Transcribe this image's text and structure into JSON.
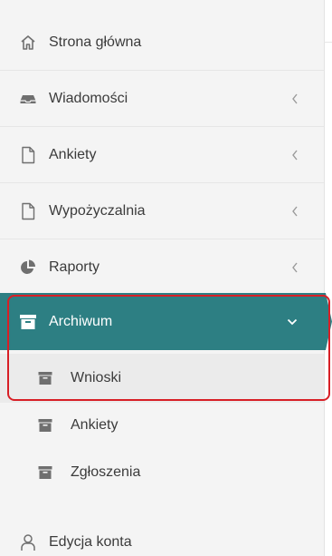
{
  "menu": {
    "items": [
      {
        "label": "Strona główna",
        "icon": "home-icon"
      },
      {
        "label": "Wiadomości",
        "icon": "inbox-icon"
      },
      {
        "label": "Ankiety",
        "icon": "file-icon"
      },
      {
        "label": "Wypożyczalnia",
        "icon": "file-icon"
      },
      {
        "label": "Raporty",
        "icon": "pie-chart-icon"
      }
    ],
    "active": {
      "label": "Archiwum",
      "icon": "archive-icon"
    },
    "subitems": [
      {
        "label": "Wnioski",
        "icon": "archive-icon",
        "selected": true
      },
      {
        "label": "Ankiety",
        "icon": "archive-icon",
        "selected": false
      },
      {
        "label": "Zgłoszenia",
        "icon": "archive-icon",
        "selected": false
      }
    ],
    "account": {
      "label": "Edycja konta",
      "icon": "user-icon"
    }
  },
  "colors": {
    "accent": "#2d7f83",
    "sidebar_bg": "#f4f4f4",
    "selected_bg": "#ebebeb",
    "highlight": "#d81f26",
    "text": "#3b3b3b",
    "icon": "#6f6f6f"
  }
}
